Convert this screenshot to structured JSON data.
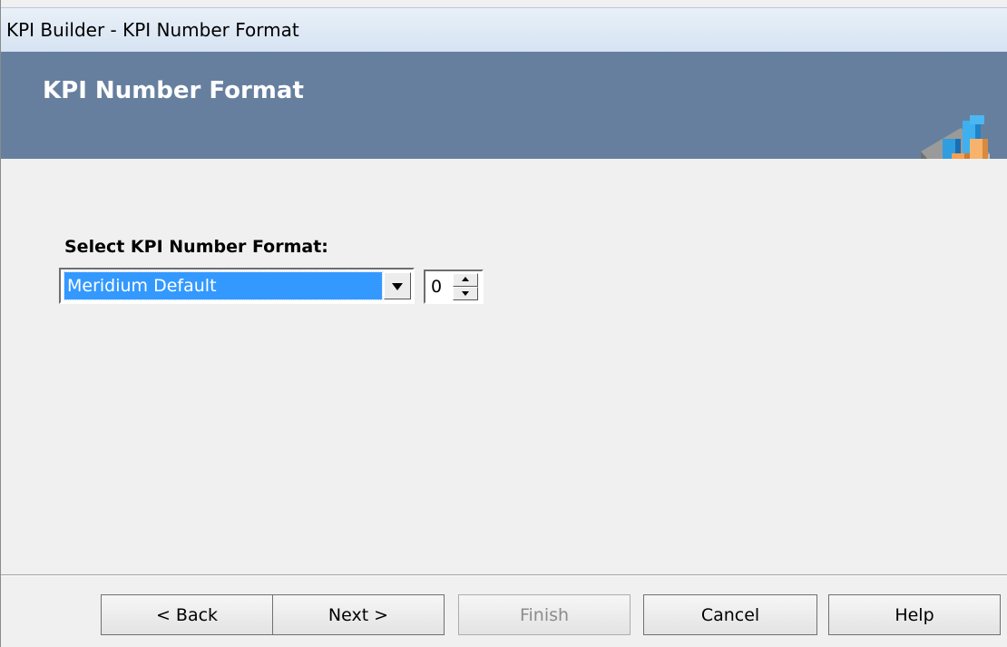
{
  "window": {
    "title": "KPI Builder - KPI Number Format"
  },
  "header": {
    "title": "KPI Number Format",
    "logo_icon": "kpi-chart-icon"
  },
  "content": {
    "select_label": "Select KPI Number Format:",
    "format_select": {
      "value": "Meridium Default"
    },
    "decimal_spinner": {
      "value": "0"
    }
  },
  "footer": {
    "back_label": "< Back",
    "next_label": "Next >",
    "finish_label": "Finish",
    "cancel_label": "Cancel",
    "help_label": "Help"
  },
  "colors": {
    "header_bg": "#667f9f",
    "selection": "#3399ff",
    "panel_bg": "#f0f0f0"
  }
}
